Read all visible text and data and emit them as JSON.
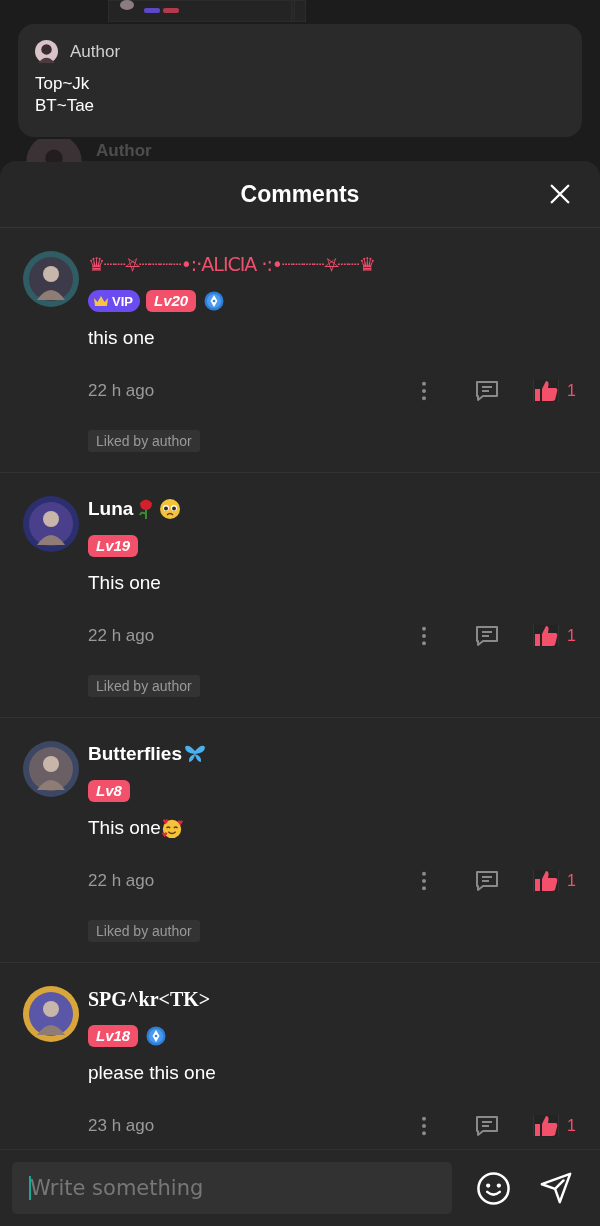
{
  "background": {
    "author_card": {
      "label": "Author",
      "lines": [
        "Top~Jk",
        "BT~Tae"
      ]
    },
    "faded_label": "Author"
  },
  "sheet": {
    "title": "Comments",
    "comments": [
      {
        "name": {
          "kind": "decorated",
          "text": "♛┈┈⛧┈┈┈┈•:·ALICIA ·:•┈┈┈┈⛧┈┈♛"
        },
        "badges": [
          {
            "kind": "vip",
            "label": "VIP"
          },
          {
            "kind": "level",
            "label": "Lv20"
          },
          {
            "kind": "pen"
          }
        ],
        "text": "this one",
        "time": "22 h ago",
        "liked": true,
        "likes": "1",
        "liked_by_author": "Liked by author"
      },
      {
        "name": {
          "kind": "plain",
          "text": "Luna"
        },
        "name_emojis": [
          {
            "kind": "rose"
          },
          {
            "kind": "pleading-face"
          }
        ],
        "badges": [
          {
            "kind": "level",
            "label": "Lv19"
          }
        ],
        "text": "This one",
        "time": "22 h ago",
        "liked": true,
        "likes": "1",
        "liked_by_author": "Liked by author"
      },
      {
        "name": {
          "kind": "plain",
          "text": "Butterflies"
        },
        "name_emojis": [
          {
            "kind": "butterfly"
          }
        ],
        "badges": [
          {
            "kind": "level",
            "label": "Lv8"
          }
        ],
        "text": "This one",
        "text_emojis": [
          {
            "kind": "smiling-hearts-face"
          }
        ],
        "time": "22 h ago",
        "liked": true,
        "likes": "1",
        "liked_by_author": "Liked by author"
      },
      {
        "name": {
          "kind": "serif",
          "text": "SPG^kr<TK>"
        },
        "badges": [
          {
            "kind": "level",
            "label": "Lv18"
          },
          {
            "kind": "pen"
          }
        ],
        "text": "please this one",
        "time": "23 h ago",
        "liked": true,
        "likes": "1"
      }
    ],
    "composer": {
      "placeholder": "Write something"
    }
  }
}
